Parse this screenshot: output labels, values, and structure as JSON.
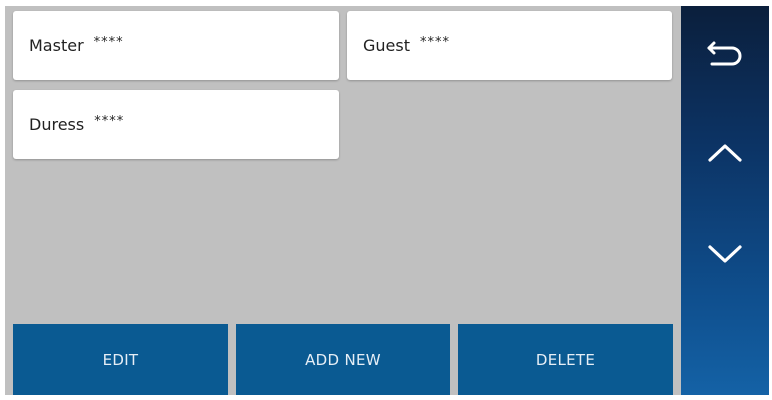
{
  "codes": [
    {
      "name": "Master",
      "mask": "****"
    },
    {
      "name": "Guest",
      "mask": "****"
    },
    {
      "name": "Duress",
      "mask": "****"
    }
  ],
  "actions": {
    "edit_label": "EDIT",
    "add_label": "ADD NEW",
    "delete_label": "DELETE"
  },
  "nav": {
    "back_icon": "back-arrow-icon",
    "up_icon": "chevron-up-icon",
    "down_icon": "chevron-down-icon"
  },
  "colors": {
    "panel_bg": "#c0c0c0",
    "button_bg": "#0a5a92",
    "nav_top": "#0b1f3c",
    "nav_bottom": "#1462a6"
  }
}
